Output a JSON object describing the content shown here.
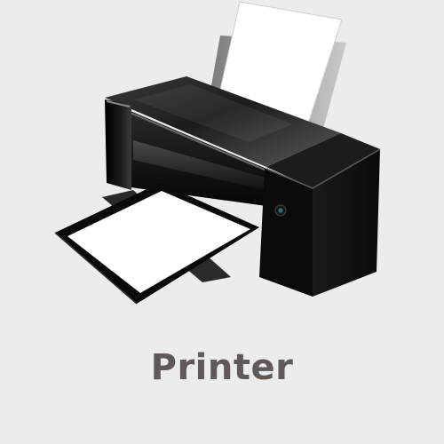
{
  "caption": {
    "label": "Printer"
  },
  "illustration": {
    "icon": "printer-icon",
    "colors": {
      "background": "#ececec",
      "body": "#0e0e0e",
      "paper": "#ffffff",
      "caption": "#5f5a58",
      "led": "#2f6d76"
    }
  }
}
